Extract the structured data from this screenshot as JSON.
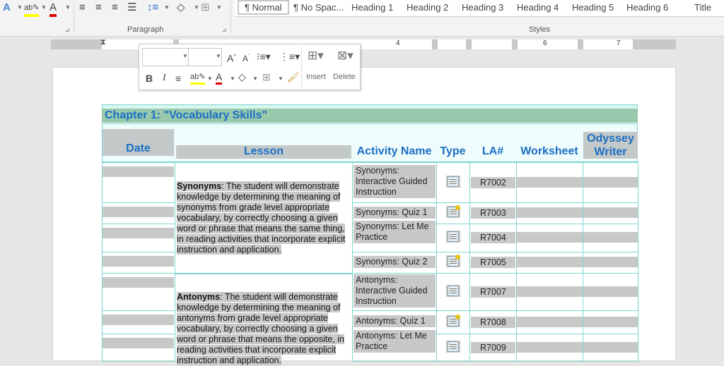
{
  "ribbon": {
    "paragraph_label": "Paragraph",
    "styles_label": "Styles",
    "styles": [
      "¶ Normal",
      "¶ No Spac...",
      "Heading 1",
      "Heading 2",
      "Heading 3",
      "Heading 4",
      "Heading 5",
      "Heading 6",
      "Title"
    ],
    "icons": [
      "text-effects-icon",
      "highlight-icon",
      "font-color-icon",
      "align-left-icon",
      "align-center-icon",
      "align-right-icon",
      "justify-icon",
      "line-spacing-icon",
      "shading-icon",
      "borders-icon"
    ]
  },
  "ruler": {
    "numbers": [
      "4",
      "6",
      "7"
    ]
  },
  "mini_toolbar": {
    "font_value": "",
    "size_value": "",
    "bold": "B",
    "italic": "I",
    "insert_label": "Insert",
    "delete_label": "Delete"
  },
  "colors": {
    "header_text": "#1a6fc4",
    "chapter_bar": "#99c9ad",
    "border": "#7fd6d0",
    "highlight": "#c8c8c8"
  },
  "table": {
    "chapter": "Chapter 1: \"Vocabulary Skills\"",
    "headers": [
      "Date",
      "Lesson",
      "Activity Name",
      "Type",
      "LA#",
      "Worksheet",
      "Odyssey Writer"
    ],
    "lessons": [
      {
        "term": "Synonyms",
        "text": ": The student will demonstrate knowledge by determining the meaning of synonyms from grade level appropriate vocabulary, by correctly choosing a given word or phrase that means the same thing, in reading activities that incorporate explicit instruction and application."
      },
      {
        "term": "Antonyms",
        "text": ": The student will demonstrate knowledge by determining the meaning of antonyms from grade level appropriate vocabulary, by correctly choosing a given word or phrase that means the opposite, in reading activities that incorporate explicit instruction and application."
      }
    ],
    "rows": [
      {
        "activity": "Synonyms: Interactive Guided Instruction",
        "type": "checklist-icon",
        "la": "R7002"
      },
      {
        "activity": "Synonyms: Quiz 1",
        "type": "quiz-icon",
        "la": "R7003"
      },
      {
        "activity": "Synonyms: Let Me Practice",
        "type": "checklist-icon",
        "la": "R7004"
      },
      {
        "activity": "Synonyms: Quiz 2",
        "type": "quiz-icon",
        "la": "R7005"
      },
      {
        "activity": "Antonyms: Interactive Guided Instruction",
        "type": "checklist-icon",
        "la": "R7007"
      },
      {
        "activity": "Antonyms: Quiz 1",
        "type": "quiz-icon",
        "la": "R7008"
      },
      {
        "activity": "Antonyms: Let Me Practice",
        "type": "checklist-icon",
        "la": "R7009"
      }
    ]
  }
}
